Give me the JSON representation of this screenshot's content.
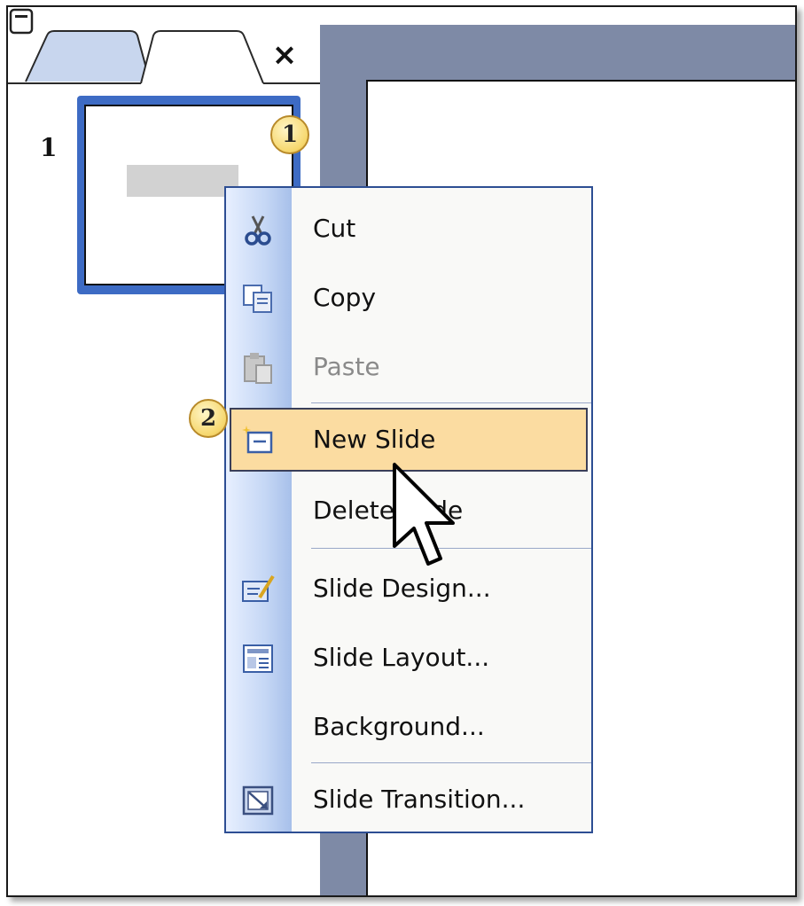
{
  "tabs": {
    "outline_icon": "outline-lines-icon",
    "slides_icon": "slide-thumbnail-icon",
    "close_label": "×"
  },
  "slide_panel": {
    "slide_number": "1"
  },
  "callouts": {
    "first": "1",
    "second": "2"
  },
  "context_menu": {
    "items": [
      {
        "label": "Cut",
        "icon": "scissors-icon",
        "enabled": true
      },
      {
        "label": "Copy",
        "icon": "copy-icon",
        "enabled": true
      },
      {
        "label": "Paste",
        "icon": "paste-icon",
        "enabled": false
      },
      {
        "label": "New Slide",
        "icon": "new-slide-icon",
        "enabled": true,
        "highlighted": true
      },
      {
        "label": "Delete Slide",
        "icon": "",
        "enabled": true
      },
      {
        "label": "Slide Design...",
        "icon": "slide-design-icon",
        "enabled": true
      },
      {
        "label": "Slide Layout...",
        "icon": "slide-layout-icon",
        "enabled": true
      },
      {
        "label": "Background...",
        "icon": "",
        "enabled": true
      },
      {
        "label": "Slide Transition...",
        "icon": "slide-transition-icon",
        "enabled": true
      }
    ]
  },
  "colors": {
    "selection_blue": "#3d6bc4",
    "menu_highlight": "#fbdca1",
    "workspace_gray": "#7e8aa6"
  }
}
